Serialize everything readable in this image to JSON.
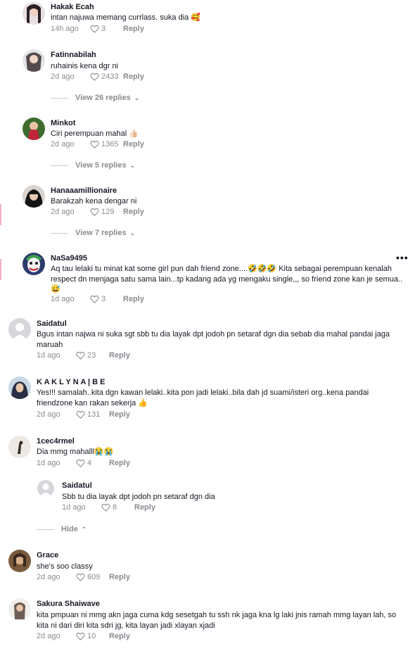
{
  "comments": [
    {
      "user": "Hakak Ecah",
      "text": "intan najuwa memang currlass. suka dia 🥰",
      "time": "14h ago",
      "likes": "3",
      "reply": "Reply"
    },
    {
      "user": "Fatinnabilah",
      "text": "ruhainis kena dgr ni",
      "time": "2d ago",
      "likes": "2433",
      "reply": "Reply",
      "view_replies": "View 26 replies"
    },
    {
      "user": "Minkot",
      "text": "Ciri perempuan mahal 👍🏻",
      "time": "2d ago",
      "likes": "1365",
      "reply": "Reply",
      "view_replies": "View 5 replies"
    },
    {
      "user": "Hanaaamillionaire",
      "text": "Barakzah kena dengar ni",
      "time": "2d ago",
      "likes": "129",
      "reply": "Reply",
      "view_replies": "View 7 replies"
    },
    {
      "user": "NaSa9495",
      "text": "Aq tau lelaki tu minat kat some girl pun dah friend zone....🤣🤣🤣 Kita sebagai perempuan kenalah respect dn menjaga satu sama lain...tp kadang ada yg mengaku single,,, so friend zone kan je semua..😅",
      "time": "1d ago",
      "likes": "3",
      "reply": "Reply",
      "more": "•••"
    },
    {
      "user": "Saidatul",
      "text": "Bgus intan najwa ni suka sgt sbb tu dia layak dpt jodoh pn setaraf dgn dia sebab dia mahal pandai jaga maruah",
      "time": "1d ago",
      "likes": "23",
      "reply": "Reply"
    },
    {
      "user": "K A K L Y N A | B E",
      "text": "Yes!!! samalah..kita dgn kawan lelaki..kita pon jadi lelaki..bila dah jd suami/isteri org..kena pandai friendzone kan rakan sekerja 👍",
      "time": "2d ago",
      "likes": "131",
      "reply": "Reply"
    },
    {
      "user": "1cec4rmel",
      "text": "Dia mmg mahalll😭😭",
      "time": "1d ago",
      "likes": "4",
      "reply": "Reply"
    },
    {
      "user": "Saidatul",
      "text": "Sbb tu dia layak dpt jodoh pn setaraf dgn dia",
      "time": "1d ago",
      "likes": "8",
      "reply": "Reply",
      "hide": "Hide"
    },
    {
      "user": "Grace",
      "text": "she's soo classy",
      "time": "2d ago",
      "likes": "609",
      "reply": "Reply"
    },
    {
      "user": "Sakura Shaiwave",
      "text": "kita pmpuan ni mmg akn jaga cuma kdg sesetgah tu ssh nk jaga kna lg laki jnis ramah mmg layan lah, so kita ni dari diri kita sdri jg, kita layan jadi xlayan xjadi",
      "time": "2d ago",
      "likes": "10",
      "reply": "Reply"
    }
  ],
  "colors": {
    "meta": "#8a8b91",
    "text": "#161823",
    "accent": "#f4b3c2"
  },
  "icons": {
    "like": "heart-outline-icon",
    "chevron": "chevron-down-icon",
    "chevron_up": "chevron-up-icon",
    "more": "more-options-icon"
  }
}
